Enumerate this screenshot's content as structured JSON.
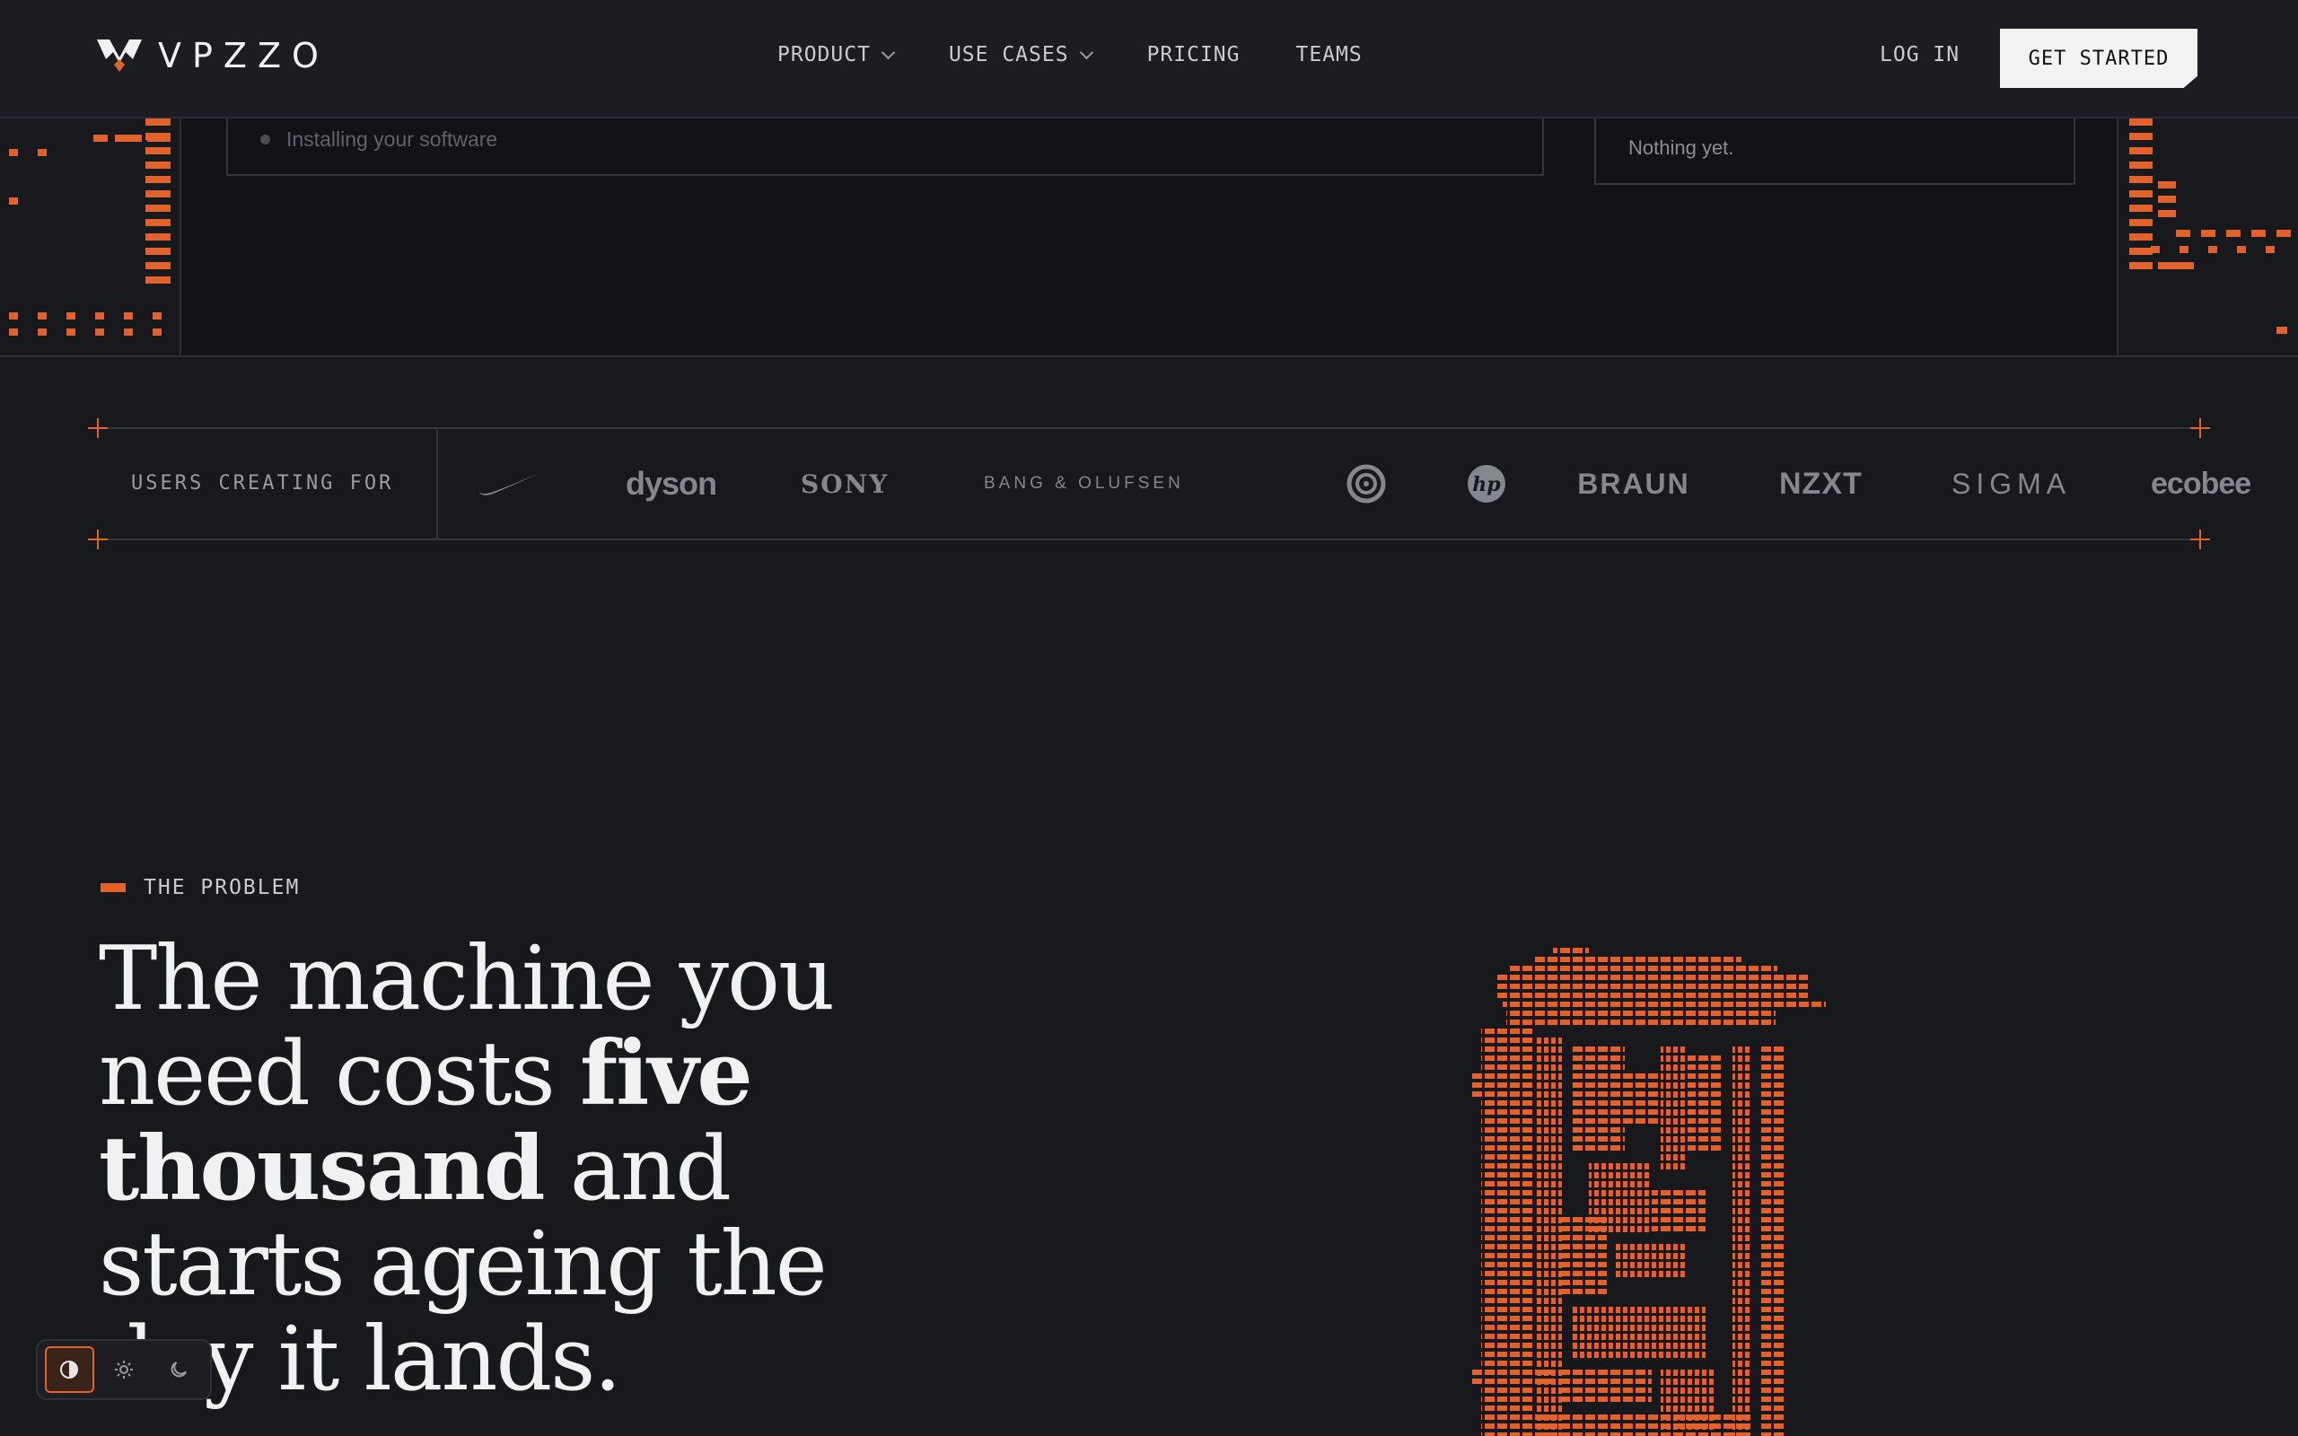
{
  "brand": {
    "name": "VPZZO"
  },
  "nav": {
    "links": [
      {
        "label": "PRODUCT"
      },
      {
        "label": "USE CASES"
      },
      {
        "label": "PRICING"
      },
      {
        "label": "TEAMS"
      }
    ],
    "login_label": "LOG IN",
    "cta_label": "GET STARTED"
  },
  "demo": {
    "list_item": "Installing your software",
    "side_panel_text": "Nothing yet."
  },
  "logos": {
    "label": "USERS CREATING FOR",
    "brands": [
      "nike",
      "dyson",
      "SONY",
      "BANG & OLUFSEN",
      "ubisoft",
      "hp",
      "BRAUN",
      "NZXT",
      "SIGMA",
      "ecobee"
    ]
  },
  "problem": {
    "eyebrow": "THE PROBLEM",
    "headline_1": "The machine you need costs ",
    "headline_bold_1": "five thousand",
    "headline_2": " and starts ageing the day it lands."
  },
  "theme_toggle": {
    "options": [
      "system-icon",
      "sun-icon",
      "moon-icon"
    ],
    "active": "system"
  },
  "colors": {
    "accent": "#e2622e",
    "background": "#17191d"
  }
}
